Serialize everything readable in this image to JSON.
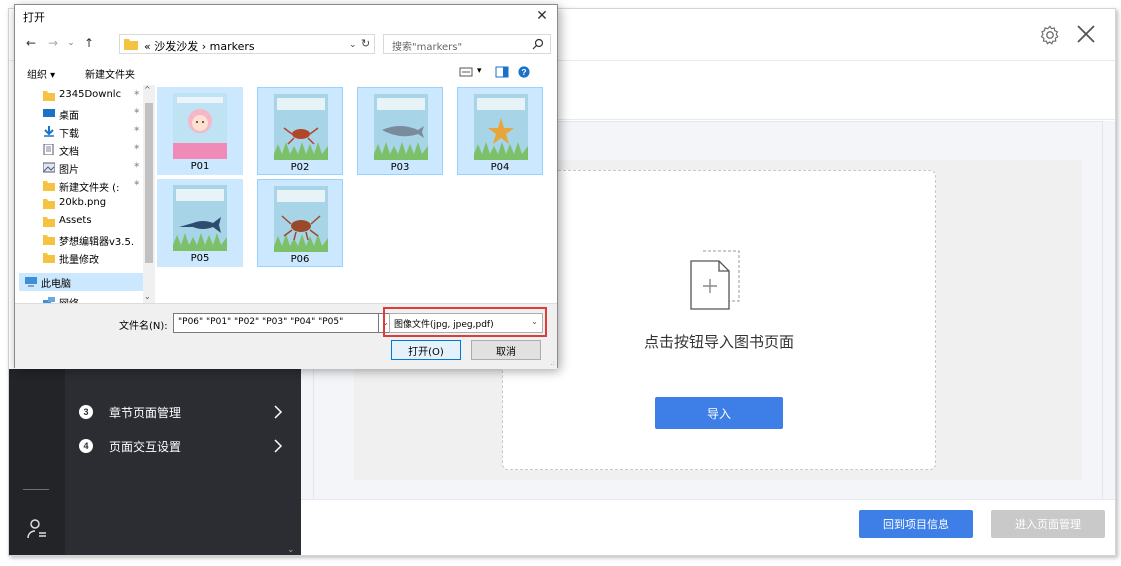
{
  "dialog": {
    "title": "打开",
    "close_glyph": "✕",
    "nav": {
      "back": "←",
      "forward": "→",
      "recent": "⌄",
      "up": "↑"
    },
    "address": "«  沙发沙发  ›  markers",
    "address_dd": "⌄",
    "address_refresh": "↻",
    "search_placeholder": "搜索\"markers\"",
    "toolbar": {
      "organize": "组织 ▾",
      "new_folder": "新建文件夹",
      "view_dd": "▾"
    },
    "tree": [
      {
        "label": "2345Downlc",
        "pin": "✶",
        "icon": "folder-icon"
      },
      {
        "label": "桌面",
        "pin": "✶",
        "icon": "desktop-icon"
      },
      {
        "label": "下载",
        "pin": "✶",
        "icon": "download-icon"
      },
      {
        "label": "文档",
        "pin": "✶",
        "icon": "document-icon"
      },
      {
        "label": "图片",
        "pin": "✶",
        "icon": "picture-icon"
      },
      {
        "label": "新建文件夹 (:",
        "pin": "✶",
        "icon": "folder-icon"
      },
      {
        "label": "20kb.png",
        "pin": "",
        "icon": "folder-icon"
      },
      {
        "label": "Assets",
        "pin": "",
        "icon": "folder-icon"
      },
      {
        "label": "梦想编辑器v3.5.",
        "pin": "",
        "icon": "folder-icon"
      },
      {
        "label": "批量修改",
        "pin": "",
        "icon": "folder-icon"
      },
      {
        "label": "此电脑",
        "pin": "",
        "icon": "computer-icon"
      },
      {
        "label": "网络",
        "pin": "",
        "icon": "network-icon"
      }
    ],
    "tree_up": "^",
    "tree_down": "⌄",
    "files": [
      {
        "label": "P01",
        "subject": "girl"
      },
      {
        "label": "P02",
        "subject": "crab"
      },
      {
        "label": "P03",
        "subject": "fish"
      },
      {
        "label": "P04",
        "subject": "starfish"
      },
      {
        "label": "P05",
        "subject": "swordfish"
      },
      {
        "label": "P06",
        "subject": "crab2"
      }
    ],
    "filename_label": "文件名(N):",
    "filename_value": "\"P06\" \"P01\" \"P02\" \"P03\" \"P04\" \"P05\"",
    "filename_dd": "⌄",
    "filetype": "图像文件(jpg, jpeg,pdf)",
    "filetype_dd": "⌄",
    "open_label": "打开(O)",
    "cancel_label": "取消",
    "grip": ".:"
  },
  "sidebar": {
    "items": [
      {
        "num": "3",
        "label": "章节页面管理",
        "chevron": "›"
      },
      {
        "num": "4",
        "label": "页面交互设置",
        "chevron": "›"
      }
    ],
    "scroll_down": "⌄"
  },
  "main": {
    "import_caption": "点击按钮导入图书页面",
    "import_button": "导入"
  },
  "footer": {
    "back_button": "回到项目信息",
    "next_button": "进入页面管理"
  },
  "colors": {
    "accent": "#3d7fe6",
    "highlight": "#e03b3b",
    "sidebar": "#2b2d33",
    "selection": "#cce8ff"
  }
}
